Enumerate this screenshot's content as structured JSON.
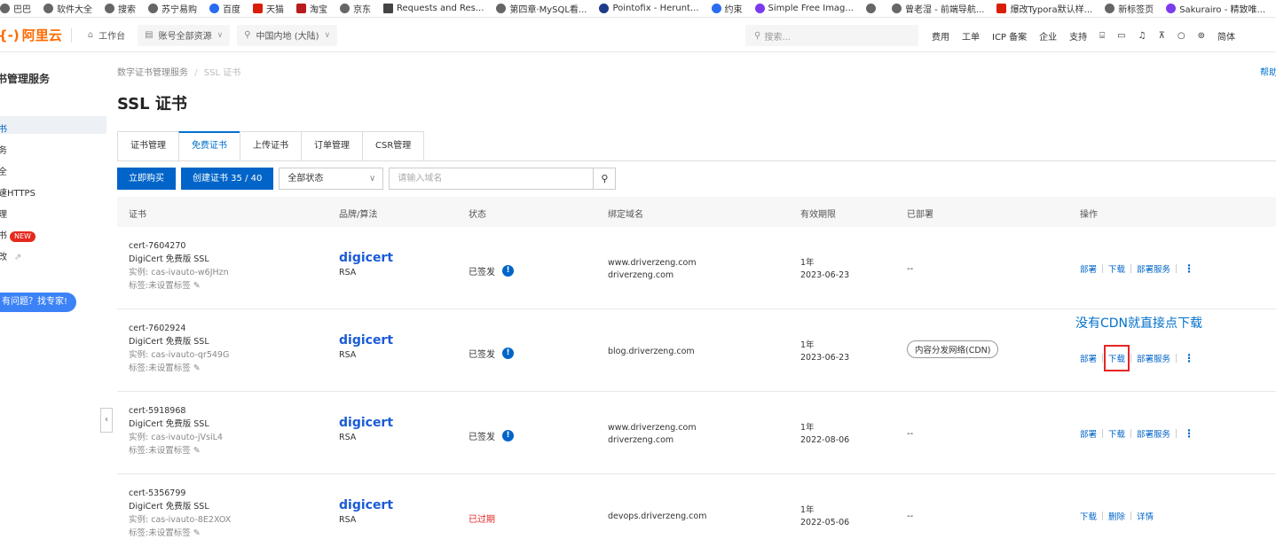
{
  "bookmarks": [
    {
      "label": "巴巴",
      "icon": "globe-icon"
    },
    {
      "label": "软件大全",
      "icon": "globe-icon"
    },
    {
      "label": "搜索",
      "icon": "globe-icon"
    },
    {
      "label": "苏宁易购",
      "icon": "globe-icon"
    },
    {
      "label": "百度",
      "icon": "baidu-icon"
    },
    {
      "label": "天猫",
      "icon": "tmall-icon"
    },
    {
      "label": "淘宝",
      "icon": "taobao-icon"
    },
    {
      "label": "京东",
      "icon": "globe-icon"
    },
    {
      "label": "Requests and Res...",
      "icon": "doc-icon"
    },
    {
      "label": "第四章·MySQL看...",
      "icon": "globe-icon"
    },
    {
      "label": "Pointofix - Herunt...",
      "icon": "app-icon"
    },
    {
      "label": "约束",
      "icon": "c-icon"
    },
    {
      "label": "Simple Free Imag...",
      "icon": "s-icon"
    },
    {
      "label": "",
      "icon": "globe-icon"
    },
    {
      "label": "曾老湿 - 前端导航...",
      "icon": "globe-icon"
    },
    {
      "label": "爆改Typora默认样...",
      "icon": "book-icon"
    },
    {
      "label": "新标签页",
      "icon": "globe-icon"
    },
    {
      "label": "Sakurairo - 精致唯...",
      "icon": "n-icon"
    }
  ],
  "topbar": {
    "logo": "阿里云",
    "workbench": "工作台",
    "resources": "账号全部资源",
    "region": "中国内地 (大陆)",
    "search_placeholder": "搜索...",
    "links": [
      "费用",
      "工单",
      "ICP 备案",
      "企业",
      "支持"
    ],
    "lang": "简体"
  },
  "sidebar": {
    "title": "书管理服务",
    "items": [
      "书",
      "务",
      "全",
      "速HTTPS",
      "理",
      "书",
      "改"
    ],
    "new_badge": "NEW",
    "expert_btn": "有问题？找专家!"
  },
  "breadcrumb": {
    "root": "数字证书管理服务",
    "sep": "/",
    "current": "SSL 证书"
  },
  "help": "帮助",
  "page_title": "SSL 证书",
  "tabs": [
    "证书管理",
    "免费证书",
    "上传证书",
    "订单管理",
    "CSR管理"
  ],
  "toolbar": {
    "buy": "立即购买",
    "create": "创建证书 35 / 40",
    "status_select": "全部状态",
    "domain_placeholder": "请输入域名"
  },
  "table": {
    "headers": [
      "证书",
      "品牌/算法",
      "状态",
      "绑定域名",
      "有效期限",
      "已部署",
      "操作"
    ],
    "rows": [
      {
        "id": "cert-7604270",
        "name": "DigiCert 免费版 SSL",
        "instance": "实例: cas-ivauto-w6JHzn",
        "tag": "标签:未设置标签",
        "brand": "digicert",
        "algo": "RSA",
        "status": "已签发",
        "domains": [
          "www.driverzeng.com",
          "driverzeng.com"
        ],
        "validity": "1年",
        "date": "2023-06-23",
        "deployed": "--",
        "ops": [
          "部署",
          "下载",
          "部署服务"
        ]
      },
      {
        "id": "cert-7602924",
        "name": "DigiCert 免费版 SSL",
        "instance": "实例: cas-ivauto-qr549G",
        "tag": "标签:未设置标签",
        "brand": "digicert",
        "algo": "RSA",
        "status": "已签发",
        "domains": [
          "blog.driverzeng.com"
        ],
        "validity": "1年",
        "date": "2023-06-23",
        "deployed": "内容分发网络(CDN)",
        "ops": [
          "部署",
          "下载",
          "部署服务"
        ]
      },
      {
        "id": "cert-5918968",
        "name": "DigiCert 免费版 SSL",
        "instance": "实例: cas-ivauto-jVsiL4",
        "tag": "标签:未设置标签",
        "brand": "digicert",
        "algo": "RSA",
        "status": "已签发",
        "domains": [
          "www.driverzeng.com",
          "driverzeng.com"
        ],
        "validity": "1年",
        "date": "2022-08-06",
        "deployed": "--",
        "ops": [
          "部署",
          "下载",
          "部署服务"
        ]
      },
      {
        "id": "cert-5356799",
        "name": "DigiCert 免费版 SSL",
        "instance": "实例: cas-ivauto-8E2XOX",
        "tag": "标签:未设置标签",
        "brand": "digicert",
        "algo": "RSA",
        "status": "已过期",
        "domains": [
          "devops.driverzeng.com"
        ],
        "validity": "1年",
        "date": "2022-05-06",
        "deployed": "--",
        "ops": [
          "下载",
          "删除",
          "详情"
        ]
      }
    ]
  },
  "annotation": "没有CDN就直接点下载",
  "colors": {
    "accent": "#0064c8",
    "orange": "#ff6a00",
    "expired": "#e52525"
  }
}
